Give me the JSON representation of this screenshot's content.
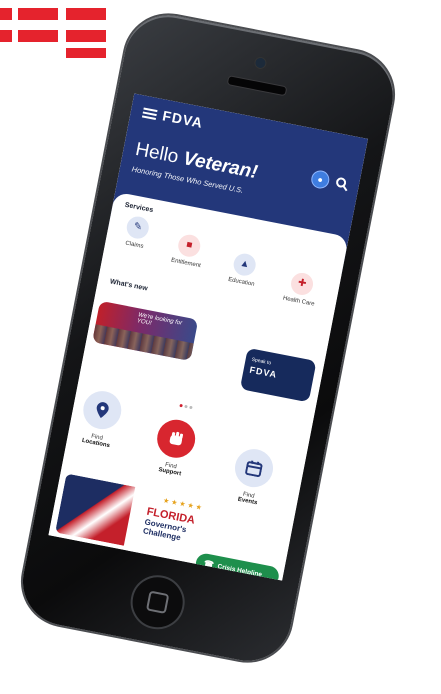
{
  "app": {
    "logo": "FDVA",
    "greeting_prefix": "Hello ",
    "greeting_name": "Veteran!",
    "tagline": "Honoring Those Who Served U.S."
  },
  "services": {
    "title": "Services",
    "items": [
      {
        "label": "Claims",
        "icon": "pencil-icon"
      },
      {
        "label": "Entitlement",
        "icon": "briefcase-icon"
      },
      {
        "label": "Education",
        "icon": "graduation-cap-icon"
      },
      {
        "label": "Health Care",
        "icon": "medical-icon"
      }
    ]
  },
  "news": {
    "title": "What's new",
    "card1_text": "We're looking for YOU!",
    "card2_line1": "Speak to",
    "card2_line2": "FDVA"
  },
  "actions": [
    {
      "line1": "Find",
      "line2": "Locations",
      "icon": "location-pin-icon"
    },
    {
      "line1": "Find",
      "line2": "Support",
      "icon": "fist-icon"
    },
    {
      "line1": "Find",
      "line2": "Events",
      "icon": "calendar-icon"
    }
  ],
  "banner": {
    "line1": "FLORIDA",
    "line2": "Governor's",
    "line3": "Challenge"
  },
  "crisis": {
    "label": "Crisis Helpline"
  },
  "colors": {
    "header": "#23377a",
    "brand_red": "#e5232d",
    "crisis_green": "#1e8f4c"
  }
}
